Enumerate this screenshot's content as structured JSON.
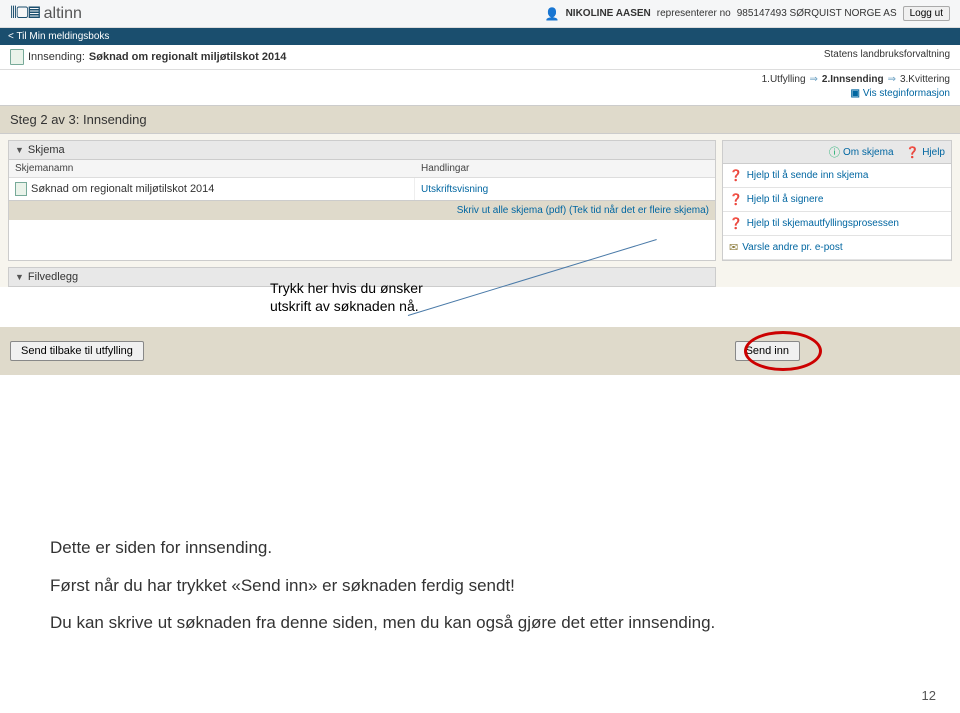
{
  "header": {
    "logo_text": "altinn",
    "user_name": "NIKOLINE AASEN",
    "represents_label": "representerer no",
    "org": "985147493 SØRQUIST NORGE AS",
    "logout": "Logg ut"
  },
  "backlink": "Til Min meldingsboks",
  "subheader": {
    "label": "Innsending:",
    "title": "Søknad om regionalt miljøtilskot 2014",
    "agency": "Statens landbruksforvaltning"
  },
  "steps": {
    "s1": "1.Utfylling",
    "s2": "2.Innsending",
    "s3": "3.Kvittering",
    "info_link": "Vis steginformasjon"
  },
  "step_title": "Steg 2 av 3: Innsending",
  "schema": {
    "header": "Skjema",
    "col_name": "Skjemanamn",
    "col_actions": "Handlingar",
    "row_name": "Søknad om regionalt miljøtilskot 2014",
    "row_action": "Utskriftsvisning",
    "print_all": "Skriv ut alle skjema (pdf) (Tek tid når det er fleire skjema)"
  },
  "side": {
    "about": "Om skjema",
    "help": "Hjelp",
    "h1": "Hjelp til å sende inn skjema",
    "h2": "Hjelp til å signere",
    "h3": "Hjelp til skjemautfyllingsprosessen",
    "notify": "Varsle andre pr. e-post"
  },
  "filvedlegg": "Filvedlegg",
  "buttons": {
    "back": "Send tilbake til utfylling",
    "send": "Send inn"
  },
  "annotation": "Trykk her hvis du ønsker utskrift av søknaden nå.",
  "explain": {
    "p1": "Dette er siden for innsending.",
    "p2": "Først når du har trykket «Send inn» er søknaden ferdig sendt!",
    "p3": "Du kan skrive ut søknaden fra denne siden, men du kan også gjøre det etter innsending."
  },
  "page_num": "12"
}
